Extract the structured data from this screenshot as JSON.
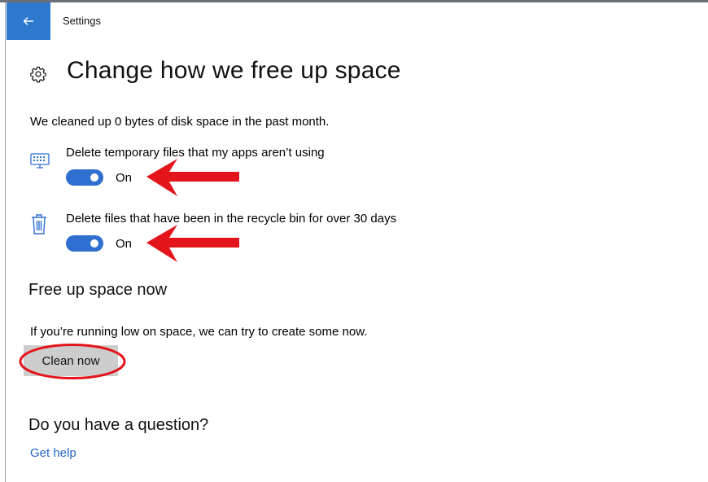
{
  "window": {
    "app_title": "Settings",
    "accent_color": "#2f78d0"
  },
  "header": {
    "back_icon": "back-arrow-icon",
    "page_icon": "gear-icon",
    "page_title": "Change how we free up space"
  },
  "storage_sense": {
    "summary": "We cleaned up 0 bytes of disk space in the past month.",
    "options": [
      {
        "icon": "monitor-icon",
        "label": "Delete temporary files that my apps aren’t using",
        "toggle_on": true,
        "toggle_state": "On"
      },
      {
        "icon": "recycle-bin-icon",
        "label": "Delete files that have been in the recycle bin for over 30 days",
        "toggle_on": true,
        "toggle_state": "On"
      }
    ],
    "toggle_color": "#2f6fd0"
  },
  "free_up_now": {
    "heading": "Free up space now",
    "description": "If you’re running low on space, we can try to create some now.",
    "button_label": "Clean now"
  },
  "help": {
    "heading": "Do you have a question?",
    "link_label": "Get help",
    "link_color": "#2565c4"
  },
  "annotations": {
    "color": "#e4141c",
    "arrow_icon": "red-arrow-annotation",
    "ellipse_icon": "red-ellipse-annotation"
  }
}
